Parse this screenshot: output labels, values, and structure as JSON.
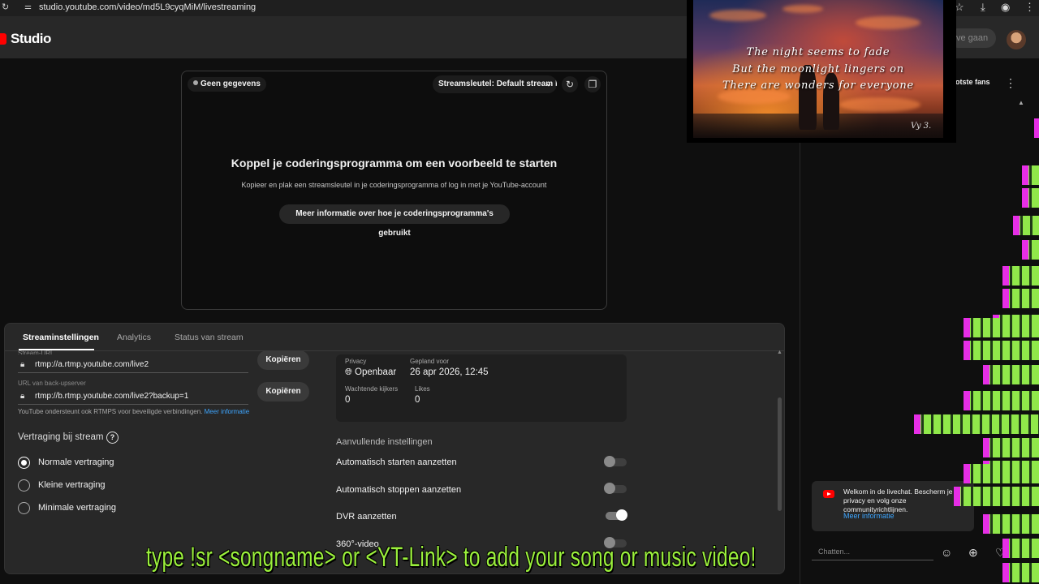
{
  "browser": {
    "url": "studio.youtube.com/video/md5L9cyqMiM/livestreaming"
  },
  "header": {
    "logo": "Studio",
    "go_live": "ve gaan"
  },
  "preview": {
    "status": "Geen gegevens",
    "stream_key": "Streamsleutel: Default stream key",
    "title": "Koppel je coderingsprogramma om een voorbeeld te starten",
    "subtitle": "Kopieer en plak een streamsleutel in je coderingsprogramma of log in met je YouTube-account",
    "button": "Meer informatie over hoe je coderingsprogramma's gebruikt"
  },
  "tabs": [
    "Streaminstellingen",
    "Analytics",
    "Status van stream"
  ],
  "stream_settings": {
    "url_label": "Stream-URL",
    "url_value": "rtmp://a.rtmp.youtube.com/live2",
    "backup_label": "URL van back-upserver",
    "backup_value": "rtmp://b.rtmp.youtube.com/live2?backup=1",
    "copy": "Kopiëren",
    "hint": "YouTube ondersteunt ook RTMPS voor beveiligde verbindingen.",
    "hint_link": "Meer informatie",
    "delay_title": "Vertraging bij stream",
    "delay_options": [
      "Normale vertraging",
      "Kleine vertraging",
      "Minimale vertraging"
    ],
    "delay_selected": 0
  },
  "info": {
    "privacy_label": "Privacy",
    "privacy_value": "Openbaar",
    "scheduled_label": "Gepland voor",
    "scheduled_value": "26 apr 2026, 12:45",
    "waiting_label": "Wachtende kijkers",
    "waiting_value": "0",
    "likes_label": "Likes",
    "likes_value": "0"
  },
  "additional": {
    "title": "Aanvullende instellingen",
    "toggles": [
      {
        "label": "Automatisch starten aanzetten",
        "on": false
      },
      {
        "label": "Automatisch stoppen aanzetten",
        "on": false
      },
      {
        "label": "DVR aanzetten",
        "on": true
      },
      {
        "label": "360°-video",
        "on": false
      }
    ]
  },
  "chat": {
    "top_fans": "rootste fans",
    "welcome": "Welkom in de livechat. Bescherm je privacy en volg onze communityrichtlijnen.",
    "more": "Meer informatie",
    "input_placeholder": "Chatten..."
  },
  "music_video": {
    "lines": [
      "The night seems to fade",
      "But the moonlight lingers on",
      "There are wonders for everyone"
    ],
    "signature": "Vy 3."
  },
  "overlay_text": "type !sr <songname> or <YT-Link>  to add your song or music video!",
  "colors": {
    "viz_green": "#90e84a",
    "viz_magenta": "#e62ee6",
    "overlay_green": "#9bf03c",
    "link_blue": "#3ea6ff"
  }
}
